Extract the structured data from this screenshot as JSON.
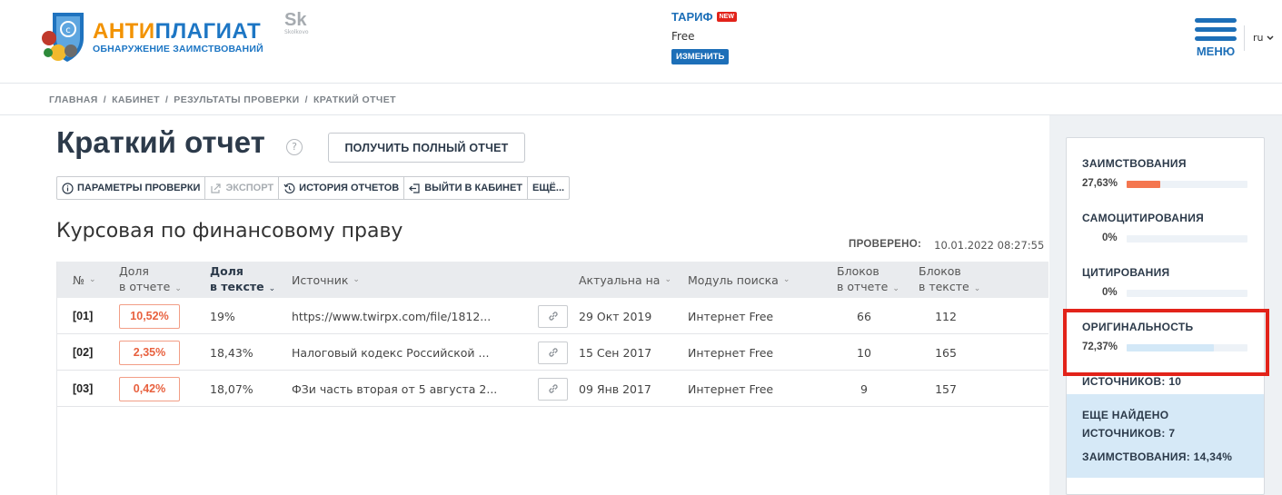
{
  "header": {
    "logo": {
      "title_part1": "АНТИ",
      "title_part2": "ПЛАГИАТ",
      "subtitle": "ОБНАРУЖЕНИЕ ЗАИМСТВОВАНИЙ"
    },
    "skolkovo": {
      "mark": "Sk",
      "label": "Skolkovo"
    },
    "tariff": {
      "title": "ТАРИФ",
      "badge": "NEW",
      "value": "Free",
      "change_label": "ИЗМЕНИТЬ"
    },
    "menu_label": "МЕНЮ",
    "language": "ru"
  },
  "breadcrumb": [
    "ГЛАВНАЯ",
    "/",
    "КАБИНЕТ",
    "/",
    "РЕЗУЛЬТАТЫ ПРОВЕРКИ",
    "/",
    "КРАТКИЙ ОТЧЕТ"
  ],
  "page": {
    "title": "Краткий отчет",
    "help": "?",
    "full_report_label": "ПОЛУЧИТЬ ПОЛНЫЙ ОТЧЕТ"
  },
  "toolbar": {
    "params": "ПАРАМЕТРЫ ПРОВЕРКИ",
    "export": "ЭКСПОРТ",
    "history": "ИСТОРИЯ ОТЧЕТОВ",
    "exit": "ВЫЙТИ В КАБИНЕТ",
    "more": "ЕЩЁ..."
  },
  "document": {
    "title": "Курсовая по финансовому праву",
    "checked_label": "ПРОВЕРЕНО:",
    "checked_value": "10.01.2022 08:27:55"
  },
  "table": {
    "headers": {
      "num": "№",
      "share_report_1": "Доля",
      "share_report_2": "в отчете",
      "share_text_1": "Доля",
      "share_text_2": "в тексте",
      "source": "Источник",
      "actual": "Актуальна на",
      "module": "Модуль поиска",
      "blocks_report_1": "Блоков",
      "blocks_report_2": "в отчете",
      "blocks_text_1": "Блоков",
      "blocks_text_2": "в тексте"
    },
    "rows": [
      {
        "num": "[01]",
        "share_report": "10,52%",
        "share_text": "19%",
        "source": "https://www.twirpx.com/file/1812...",
        "actual": "29 Окт 2019",
        "module": "Интернет Free",
        "blocks_report": "66",
        "blocks_text": "112"
      },
      {
        "num": "[02]",
        "share_report": "2,35%",
        "share_text": "18,43%",
        "source": "Налоговый кодекс Российской ...",
        "actual": "15 Сен 2017",
        "module": "Интернет Free",
        "blocks_report": "10",
        "blocks_text": "165"
      },
      {
        "num": "[03]",
        "share_report": "0,42%",
        "share_text": "18,07%",
        "source": "ФЗи часть вторая от 5 августа 2...",
        "actual": "09 Янв 2017",
        "module": "Интернет Free",
        "blocks_report": "9",
        "blocks_text": "157"
      }
    ]
  },
  "summary": {
    "borrowing": {
      "label": "ЗАИМСТВОВАНИЯ",
      "value": "27,63%",
      "fraction": 0.2763,
      "color": "#f4764f"
    },
    "self_citation": {
      "label": "САМОЦИТИРОВАНИЯ",
      "value": "0%",
      "fraction": 0,
      "color": "#f4764f"
    },
    "citation": {
      "label": "ЦИТИРОВАНИЯ",
      "value": "0%",
      "fraction": 0,
      "color": "#7ec3e8"
    },
    "originality": {
      "label": "ОРИГИНАЛЬНОСТЬ",
      "value": "72,37%",
      "fraction": 0.7237,
      "color": "#d3e8f7"
    },
    "sources": "ИСТОЧНИКОВ:  10",
    "found_line1": "ЕЩЕ НАЙДЕНО",
    "found_line2": "ИСТОЧНИКОВ: 7",
    "found_line3": "ЗАИМСТВОВАНИЯ:  14,34%"
  }
}
